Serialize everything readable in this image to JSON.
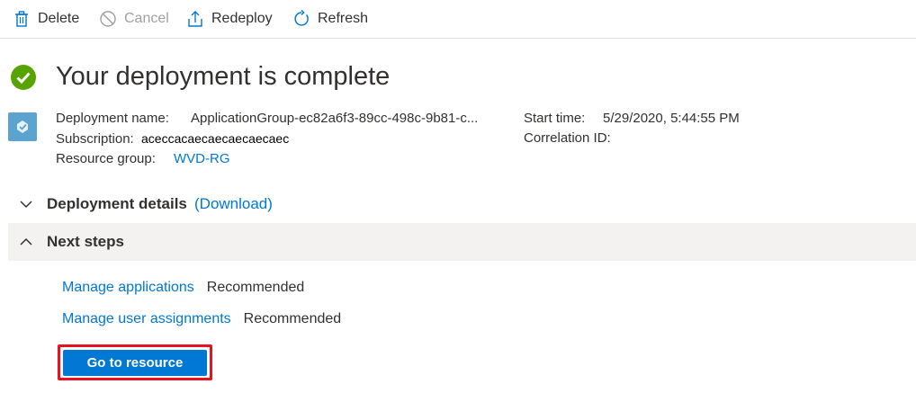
{
  "toolbar": {
    "delete_label": "Delete",
    "cancel_label": "Cancel",
    "redeploy_label": "Redeploy",
    "refresh_label": "Refresh"
  },
  "header": {
    "title": "Your deployment is complete"
  },
  "summary": {
    "deployment_name_label": "Deployment name:",
    "deployment_name_value": "ApplicationGroup-ec82a6f3-89cc-498c-9b81-c...",
    "subscription_label": "Subscription:",
    "subscription_value": "aceccacaecaecaecaecaec",
    "resource_group_label": "Resource group:",
    "resource_group_value": "WVD-RG",
    "start_time_label": "Start time:",
    "start_time_value": "5/29/2020, 5:44:55 PM",
    "correlation_id_label": "Correlation ID:",
    "correlation_id_value": ""
  },
  "sections": {
    "deployment_details": {
      "title": "Deployment details",
      "download_label": "(Download)",
      "expanded": false
    },
    "next_steps": {
      "title": "Next steps",
      "expanded": true
    }
  },
  "next_steps": {
    "items": [
      {
        "link": "Manage applications",
        "note": "Recommended"
      },
      {
        "link": "Manage user assignments",
        "note": "Recommended"
      }
    ],
    "primary_button": "Go to resource"
  },
  "colors": {
    "accent": "#0078d4",
    "success": "#57a300",
    "highlight": "#e81123"
  },
  "icons": {
    "delete": "trash-icon",
    "cancel": "cancel-icon",
    "redeploy": "upload-icon",
    "refresh": "refresh-icon",
    "status": "check-circle-icon",
    "resource": "deployment-cube-icon"
  }
}
